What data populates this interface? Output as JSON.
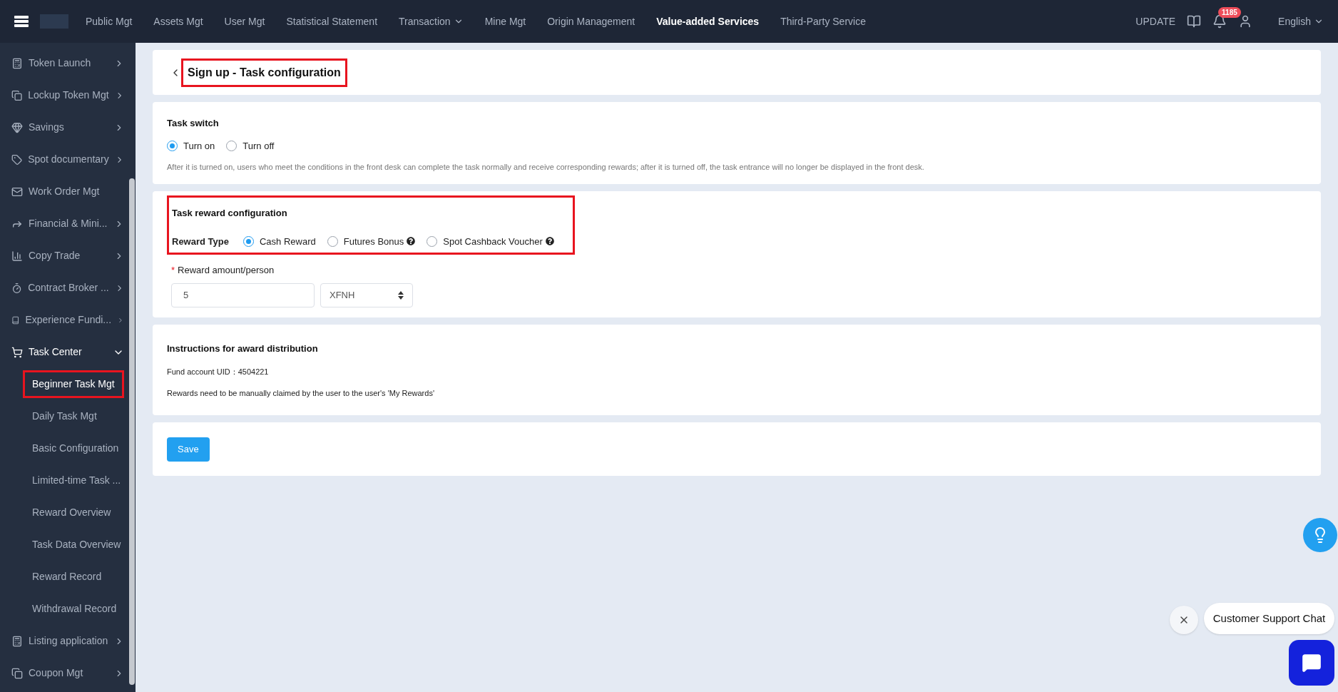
{
  "topbar": {
    "nav": [
      {
        "label": "Public Mgt",
        "selected": false,
        "dropdown": false
      },
      {
        "label": "Assets Mgt",
        "selected": false,
        "dropdown": false
      },
      {
        "label": "User Mgt",
        "selected": false,
        "dropdown": false
      },
      {
        "label": "Statistical Statement",
        "selected": false,
        "dropdown": false
      },
      {
        "label": "Transaction",
        "selected": false,
        "dropdown": true
      },
      {
        "label": "Mine Mgt",
        "selected": false,
        "dropdown": false
      },
      {
        "label": "Origin Management",
        "selected": false,
        "dropdown": false
      },
      {
        "label": "Value-added Services",
        "selected": true,
        "dropdown": false
      },
      {
        "label": "Third-Party Service",
        "selected": false,
        "dropdown": false
      }
    ],
    "update": "UPDATE",
    "notification_count": "1185",
    "language": "English"
  },
  "sidebar": {
    "items": [
      {
        "label": "Token Launch",
        "expanded": false
      },
      {
        "label": "Lockup Token Mgt",
        "expanded": false
      },
      {
        "label": "Savings",
        "expanded": false
      },
      {
        "label": "Spot documentary",
        "expanded": false
      },
      {
        "label": "Work Order Mgt"
      },
      {
        "label": "Financial & Mini...",
        "expanded": false
      },
      {
        "label": "Copy Trade",
        "expanded": false
      },
      {
        "label": "Contract Broker ...",
        "expanded": false
      },
      {
        "label": "Experience Fundi...",
        "expanded": false
      },
      {
        "label": "Task Center",
        "expanded": true,
        "children": [
          {
            "label": "Beginner Task Mgt",
            "selected": true,
            "highlighted": true
          },
          {
            "label": "Daily Task Mgt",
            "selected": false,
            "highlighted": false
          },
          {
            "label": "Basic Configuration",
            "selected": false,
            "highlighted": false
          },
          {
            "label": "Limited-time Task ...",
            "selected": false,
            "highlighted": false
          },
          {
            "label": "Reward Overview",
            "selected": false,
            "highlighted": false
          },
          {
            "label": "Task Data Overview",
            "selected": false,
            "highlighted": false
          },
          {
            "label": "Reward Record",
            "selected": false,
            "highlighted": false
          },
          {
            "label": "Withdrawal Record",
            "selected": false,
            "highlighted": false
          }
        ]
      },
      {
        "label": "Listing application",
        "expanded": false
      },
      {
        "label": "Coupon Mgt",
        "expanded": false
      }
    ]
  },
  "page": {
    "title": "Sign up - Task configuration",
    "title_highlighted": true,
    "task_switch": {
      "heading": "Task switch",
      "options": [
        {
          "label": "Turn on",
          "selected": true
        },
        {
          "label": "Turn off",
          "selected": false
        }
      ],
      "note": "After it is turned on, users who meet the conditions in the front desk can complete the task normally and receive corresponding rewards; after it is turned off, the task entrance will no longer be displayed in the front desk."
    },
    "reward": {
      "heading": "Task reward configuration",
      "highlighted": true,
      "type_label": "Reward Type",
      "options": [
        {
          "label": "Cash Reward",
          "selected": true,
          "help": false
        },
        {
          "label": "Futures Bonus",
          "selected": false,
          "help": true
        },
        {
          "label": "Spot Cashback Voucher",
          "selected": false,
          "help": true
        }
      ],
      "required_mark": "*",
      "amount_label": "Reward amount/person",
      "amount_value": "5",
      "currency": "XFNH"
    },
    "instructions": {
      "heading": "Instructions for award distribution",
      "lines": [
        "Fund account UID：4504221",
        "Rewards need to be manually claimed by the user to the user's 'My Rewards'"
      ]
    },
    "save": "Save"
  },
  "chat": {
    "label": "Customer Support Chat"
  }
}
